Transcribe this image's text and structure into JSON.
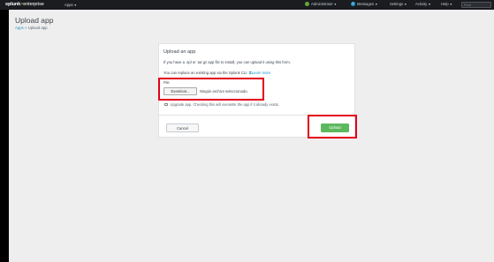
{
  "topbar": {
    "logo_brand": "splunk",
    "logo_gt": ">",
    "logo_product": "enterprise",
    "apps_label": "Apps",
    "user_label": "Administrator",
    "messages_count": "2",
    "messages_label": "Messages",
    "settings_label": "Settings",
    "activity_label": "Activity",
    "help_label": "Help",
    "find_placeholder": "Find"
  },
  "page": {
    "title": "Upload app",
    "breadcrumb_link": "Apps",
    "breadcrumb_sep": "»",
    "breadcrumb_current": "Upload app"
  },
  "panel": {
    "title": "Upload an app",
    "description": "If you have a .spl or .tar.gz app file to install, you can upload it using this form.",
    "replace_text": "You can replace an existing app via the Splunk CLI.",
    "learn_more": "Learn more.",
    "file_label": "File",
    "browse_label": "Examinar...",
    "file_status": "Ningún archivo seleccionado.",
    "upgrade_label": "Upgrade app. Checking this will overwrite the app if it already exists.",
    "cancel_label": "Cancel",
    "upload_label": "Upload"
  },
  "colors": {
    "accent_green": "#5cb85c",
    "link_blue": "#1e93c6",
    "highlight_red": "#e4001b",
    "user_status_green": "#65a637",
    "messages_badge_blue": "#1e93c6"
  }
}
